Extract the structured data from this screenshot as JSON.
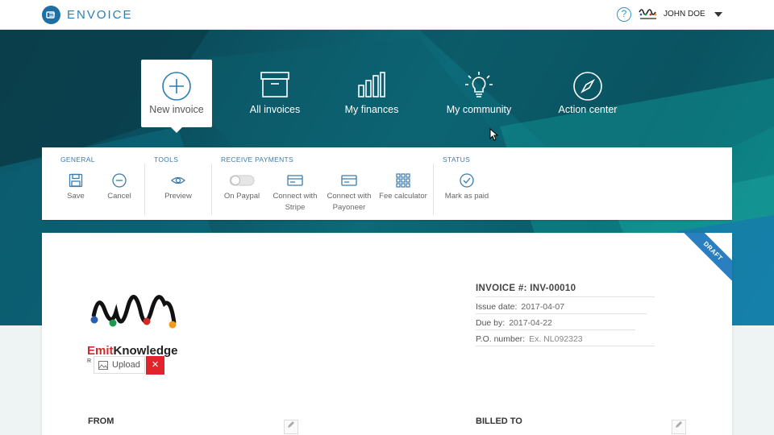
{
  "app": {
    "name": "ENVOICE"
  },
  "topbar": {
    "help": "?",
    "user_name": "JOHN DOE"
  },
  "nav": [
    {
      "label": "New invoice",
      "icon": "plus-circle-icon",
      "active": true
    },
    {
      "label": "All invoices",
      "icon": "archive-box-icon",
      "active": false
    },
    {
      "label": "My finances",
      "icon": "bar-chart-icon",
      "active": false
    },
    {
      "label": "My community",
      "icon": "lightbulb-icon",
      "active": false
    },
    {
      "label": "Action center",
      "icon": "compass-icon",
      "active": false
    }
  ],
  "toolbar": {
    "groups": [
      "GENERAL",
      "TOOLS",
      "RECEIVE PAYMENTS",
      "STATUS"
    ],
    "save": "Save",
    "cancel": "Cancel",
    "preview": "Preview",
    "on_paypal": "On Paypal",
    "connect_stripe_1": "Connect with",
    "connect_stripe_2": "Stripe",
    "connect_payoneer_1": "Connect with",
    "connect_payoneer_2": "Payoneer",
    "fee_calculator": "Fee calculator",
    "mark_as_paid": "Mark as paid"
  },
  "invoice": {
    "ribbon": "DRAFT",
    "number_label": "INVOICE #:",
    "number": "INV-00010",
    "issue_label": "Issue date:",
    "issue_date": "2017-04-07",
    "due_label": "Due by:",
    "due_date": "2017-04-22",
    "po_label": "P.O. number:",
    "po_placeholder": "Ex. NL092323",
    "logo_name_1": "Emit",
    "logo_name_2": "Knowledge",
    "logo_tagline": "R              ncies",
    "upload_label": "Upload",
    "remove_label": "×",
    "from_label": "FROM",
    "billed_to_label": "BILLED TO"
  },
  "colors": {
    "accent": "#2a7fb0",
    "danger": "#e0242a",
    "hero_dark": "#0c4350",
    "hero_light": "#0e8a8c"
  }
}
